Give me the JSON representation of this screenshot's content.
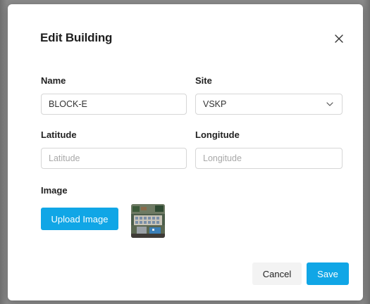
{
  "dialog": {
    "title": "Edit Building",
    "close_icon": "close-icon"
  },
  "form": {
    "name": {
      "label": "Name",
      "value": "BLOCK-E"
    },
    "site": {
      "label": "Site",
      "selected": "VSKP",
      "icon": "chevron-down-icon"
    },
    "latitude": {
      "label": "Latitude",
      "value": "",
      "placeholder": "Latitude"
    },
    "longitude": {
      "label": "Longitude",
      "value": "",
      "placeholder": "Longitude"
    },
    "image": {
      "label": "Image",
      "upload_label": "Upload Image"
    }
  },
  "footer": {
    "cancel_label": "Cancel",
    "save_label": "Save"
  },
  "colors": {
    "primary": "#10a6e6",
    "secondary_button": "#f3f3f3",
    "border": "#d6d6d6",
    "text": "#222222"
  }
}
